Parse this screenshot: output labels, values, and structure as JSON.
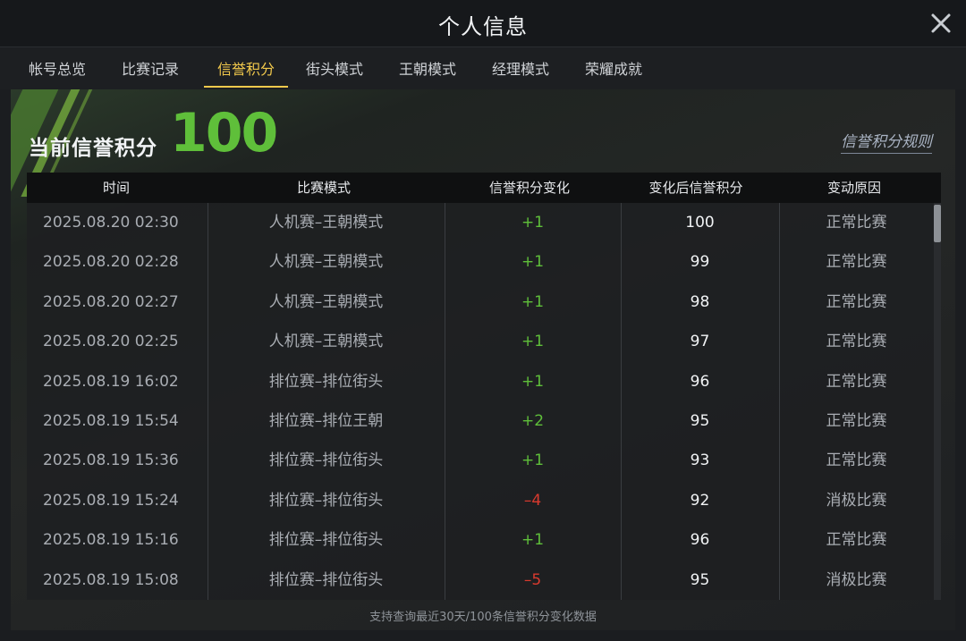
{
  "window": {
    "title": "个人信息"
  },
  "tabs": [
    {
      "label": "帐号总览"
    },
    {
      "label": "比赛记录"
    },
    {
      "label": "信誉积分"
    },
    {
      "label": "街头模式"
    },
    {
      "label": "王朝模式"
    },
    {
      "label": "经理模式"
    },
    {
      "label": "荣耀成就"
    }
  ],
  "active_tab": "信誉积分",
  "score": {
    "label": "当前信誉积分",
    "value": "100",
    "color": "#5fbf3a"
  },
  "rules_link": "信誉积分规则",
  "table": {
    "columns": [
      "时间",
      "比赛模式",
      "信誉积分变化",
      "变化后信誉积分",
      "变动原因"
    ],
    "rows": [
      {
        "time": "2025.08.20  02:30",
        "mode": "人机赛–王朝模式",
        "change": "+1",
        "after": "100",
        "reason": "正常比赛"
      },
      {
        "time": "2025.08.20  02:28",
        "mode": "人机赛–王朝模式",
        "change": "+1",
        "after": "99",
        "reason": "正常比赛"
      },
      {
        "time": "2025.08.20  02:27",
        "mode": "人机赛–王朝模式",
        "change": "+1",
        "after": "98",
        "reason": "正常比赛"
      },
      {
        "time": "2025.08.20  02:25",
        "mode": "人机赛–王朝模式",
        "change": "+1",
        "after": "97",
        "reason": "正常比赛"
      },
      {
        "time": "2025.08.19  16:02",
        "mode": "排位赛–排位街头",
        "change": "+1",
        "after": "96",
        "reason": "正常比赛"
      },
      {
        "time": "2025.08.19  15:54",
        "mode": "排位赛–排位王朝",
        "change": "+2",
        "after": "95",
        "reason": "正常比赛"
      },
      {
        "time": "2025.08.19  15:36",
        "mode": "排位赛–排位街头",
        "change": "+1",
        "after": "93",
        "reason": "正常比赛"
      },
      {
        "time": "2025.08.19  15:24",
        "mode": "排位赛–排位街头",
        "change": "–4",
        "after": "92",
        "reason": "消极比赛"
      },
      {
        "time": "2025.08.19  15:16",
        "mode": "排位赛–排位街头",
        "change": "+1",
        "after": "96",
        "reason": "正常比赛"
      },
      {
        "time": "2025.08.19  15:08",
        "mode": "排位赛–排位街头",
        "change": "–5",
        "after": "95",
        "reason": "消极比赛"
      }
    ]
  },
  "footnote": "支持查询最近30天/100条信誉积分变化数据",
  "colors": {
    "accent": "#f2c94c",
    "positive": "#5fbf3a",
    "negative": "#d93a2e"
  },
  "icons": {
    "close": "close-icon"
  }
}
